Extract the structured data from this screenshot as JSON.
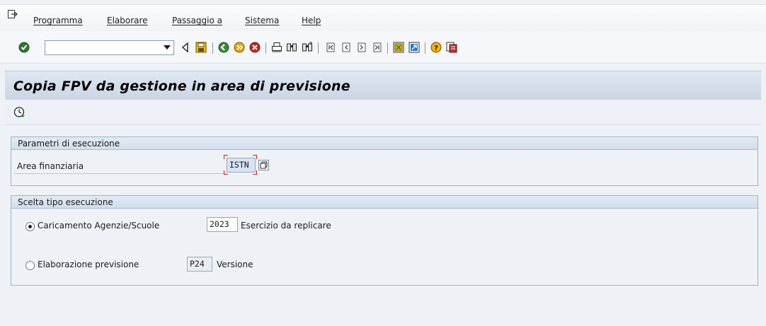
{
  "menu": {
    "items": [
      {
        "label": "Programma"
      },
      {
        "label": "Elaborare"
      },
      {
        "label": "Passaggio a"
      },
      {
        "label": "Sistema"
      },
      {
        "label": "Help"
      }
    ]
  },
  "toolbar": {
    "command_field_value": "",
    "icons": [
      "enter-icon",
      "back-triangle-icon",
      "save-icon",
      "back-green-icon",
      "exit-yellow-icon",
      "cancel-red-icon",
      "print-icon",
      "find-icon",
      "find-next-icon",
      "first-page-icon",
      "previous-page-icon",
      "next-page-icon",
      "last-page-icon",
      "create-session-icon",
      "shortcut-icon",
      "help-icon",
      "customize-layout-icon"
    ]
  },
  "screen": {
    "title": "Copia FPV da gestione in area di previsione",
    "execute_icon": "execute-clock-icon"
  },
  "group_params": {
    "title": "Parametri di esecuzione",
    "area_label": "Area finanziaria",
    "area_value": "ISTN"
  },
  "group_exec": {
    "title": "Scelta tipo esecuzione",
    "option1_label": "Caricamento Agenzie/Scuole",
    "option1_selected": true,
    "year_value": "2023",
    "year_label": "Esercizio da replicare",
    "option2_label": "Elaborazione previsione",
    "option2_selected": false,
    "version_value": "P24",
    "version_label": "Versione"
  }
}
